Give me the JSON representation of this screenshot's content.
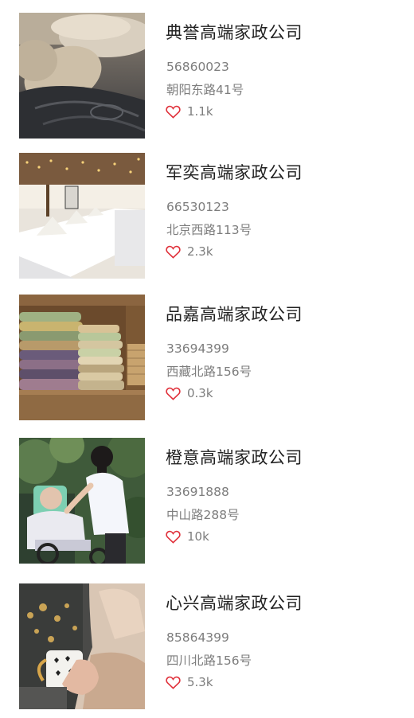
{
  "accent_color": "#e0303a",
  "items": [
    {
      "name": "典誉高端家政公司",
      "phone": "56860023",
      "address": "朝阳东路41号",
      "likes": "1.1k",
      "image": "pillows-on-sofa-photo",
      "like_icon": "heart-outline-icon"
    },
    {
      "name": "军奕高端家政公司",
      "phone": "66530123",
      "address": "北京西路113号",
      "likes": "2.3k",
      "image": "banquet-table-photo",
      "like_icon": "heart-outline-icon"
    },
    {
      "name": "品嘉高端家政公司",
      "phone": "33694399",
      "address": "西藏北路156号",
      "likes": "0.3k",
      "image": "folded-towels-shelf-photo",
      "like_icon": "heart-outline-icon"
    },
    {
      "name": "橙意高端家政公司",
      "phone": "33691888",
      "address": "中山路288号",
      "likes": "10k",
      "image": "caregiver-elder-wheelchair-photo",
      "like_icon": "heart-outline-icon"
    },
    {
      "name": "心兴高端家政公司",
      "phone": "85864399",
      "address": "四川北路156号",
      "likes": "5.3k",
      "image": "woman-holding-cup-photo",
      "like_icon": "heart-outline-icon"
    }
  ]
}
